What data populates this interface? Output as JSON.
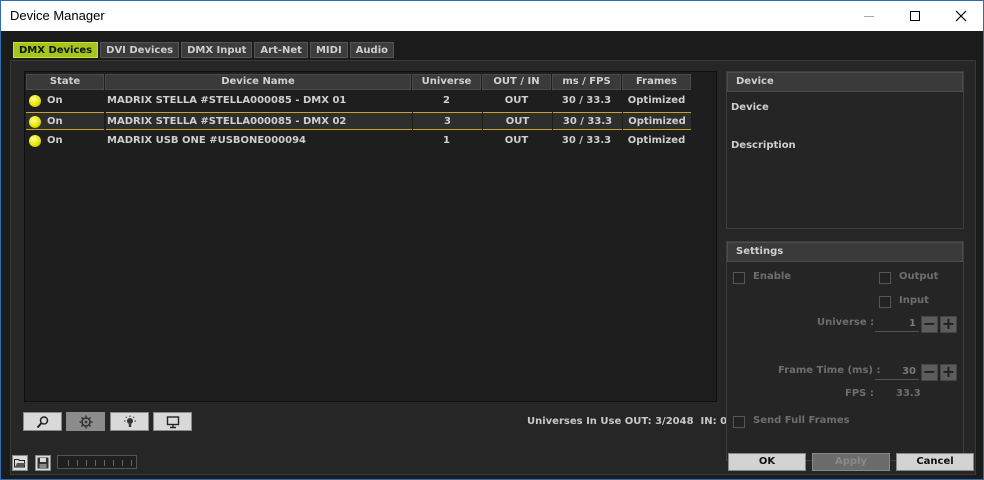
{
  "window": {
    "title": "Device Manager"
  },
  "tabs": [
    "DMX Devices",
    "DVI Devices",
    "DMX Input",
    "Art-Net",
    "MIDI",
    "Audio"
  ],
  "table": {
    "headers": [
      "State",
      "Device Name",
      "Universe",
      "OUT / IN",
      "ms / FPS",
      "Frames"
    ],
    "rows": [
      {
        "state": "On",
        "device": "MADRIX STELLA #STELLA000085 - DMX 01",
        "universe": "2",
        "outin": "OUT",
        "msfps": "30 / 33.3",
        "frames": "Optimized"
      },
      {
        "state": "On",
        "device": "MADRIX STELLA #STELLA000085 - DMX 02",
        "universe": "3",
        "outin": "OUT",
        "msfps": "30 / 33.3",
        "frames": "Optimized"
      },
      {
        "state": "On",
        "device": "MADRIX USB ONE #USBONE000094",
        "universe": "1",
        "outin": "OUT",
        "msfps": "30 / 33.3",
        "frames": "Optimized"
      }
    ],
    "selected_row": 1
  },
  "toolbar_icons": [
    "search-icon",
    "gear-icon",
    "lightbulb-icon",
    "monitor-icon"
  ],
  "status": "Universes In Use OUT: 3/2048  IN: 0",
  "device_panel": {
    "title": "Device",
    "device_label": "Device",
    "description_label": "Description"
  },
  "settings_panel": {
    "title": "Settings",
    "enable_label": "Enable",
    "output_label": "Output",
    "input_label": "Input",
    "universe_label": "Universe :",
    "universe_value": "1",
    "frame_time_label": "Frame Time (ms) :",
    "frame_time_value": "30",
    "fps_label": "FPS :",
    "fps_value": "33.3",
    "send_full_frames_label": "Send Full Frames"
  },
  "buttons": {
    "ok": "OK",
    "apply": "Apply",
    "cancel": "Cancel"
  },
  "colors": {
    "accent": "#a6c51c",
    "selection_border": "#c9a227",
    "led": "#e6e600"
  }
}
